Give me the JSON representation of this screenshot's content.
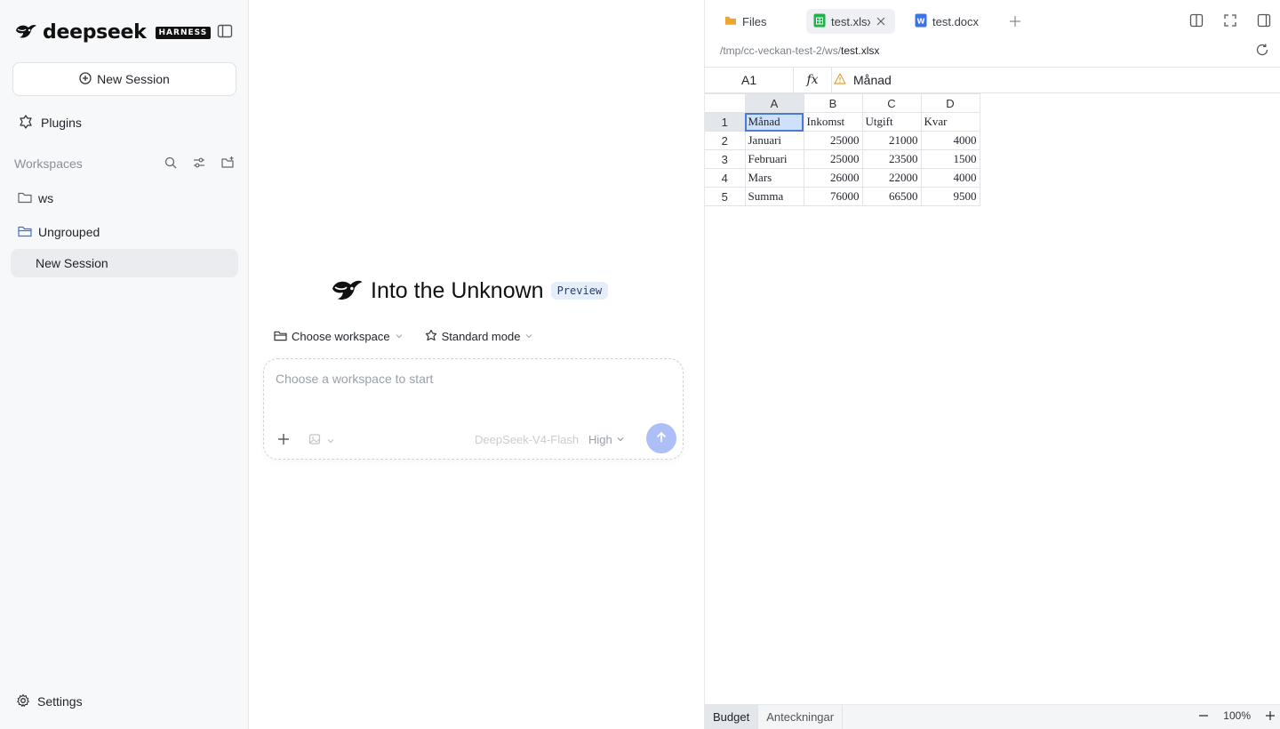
{
  "sidebar": {
    "brand_name": "deepseek",
    "brand_badge": "HARNESS",
    "new_session_label": "New Session",
    "plugins_label": "Plugins",
    "workspaces_label": "Workspaces",
    "tree": [
      {
        "label": "ws"
      },
      {
        "label": "Ungrouped"
      }
    ],
    "session_label": "New Session",
    "settings_label": "Settings"
  },
  "center": {
    "title": "Into the Unknown",
    "badge": "Preview",
    "workspace_select": "Choose workspace",
    "mode_select": "Standard mode",
    "composer_placeholder": "Choose a workspace to start",
    "model": "DeepSeek-V4-Flash",
    "effort": "High"
  },
  "pane": {
    "tabs": [
      {
        "label": "Files",
        "icon": "folder-icon"
      },
      {
        "label": "test.xlsx",
        "icon": "sheet-icon",
        "active": true
      },
      {
        "label": "test.docx",
        "icon": "word-icon"
      }
    ],
    "path_prefix": "/tmp/cc-veckan-test-2/ws/",
    "path_file": "test.xlsx",
    "cell_ref": "A1",
    "fx_label": "fx",
    "formula_value": "Månad",
    "columns": [
      "A",
      "B",
      "C",
      "D"
    ],
    "rows": [
      {
        "n": "1",
        "cells": [
          "Månad",
          "Inkomst",
          "Utgift",
          "Kvar"
        ]
      },
      {
        "n": "2",
        "cells": [
          "Januari",
          "25000",
          "21000",
          "4000"
        ]
      },
      {
        "n": "3",
        "cells": [
          "Februari",
          "25000",
          "23500",
          "1500"
        ]
      },
      {
        "n": "4",
        "cells": [
          "Mars",
          "26000",
          "22000",
          "4000"
        ]
      },
      {
        "n": "5",
        "cells": [
          "Summa",
          "76000",
          "66500",
          "9500"
        ]
      }
    ],
    "sheets": [
      "Budget",
      "Anteckningar"
    ],
    "zoom": "100%"
  },
  "colors": {
    "accent": "#4a7bd0",
    "send_button": "#aebff8",
    "preview_badge_bg": "#e7eefb",
    "sidebar_bg": "#f7f8fa"
  }
}
